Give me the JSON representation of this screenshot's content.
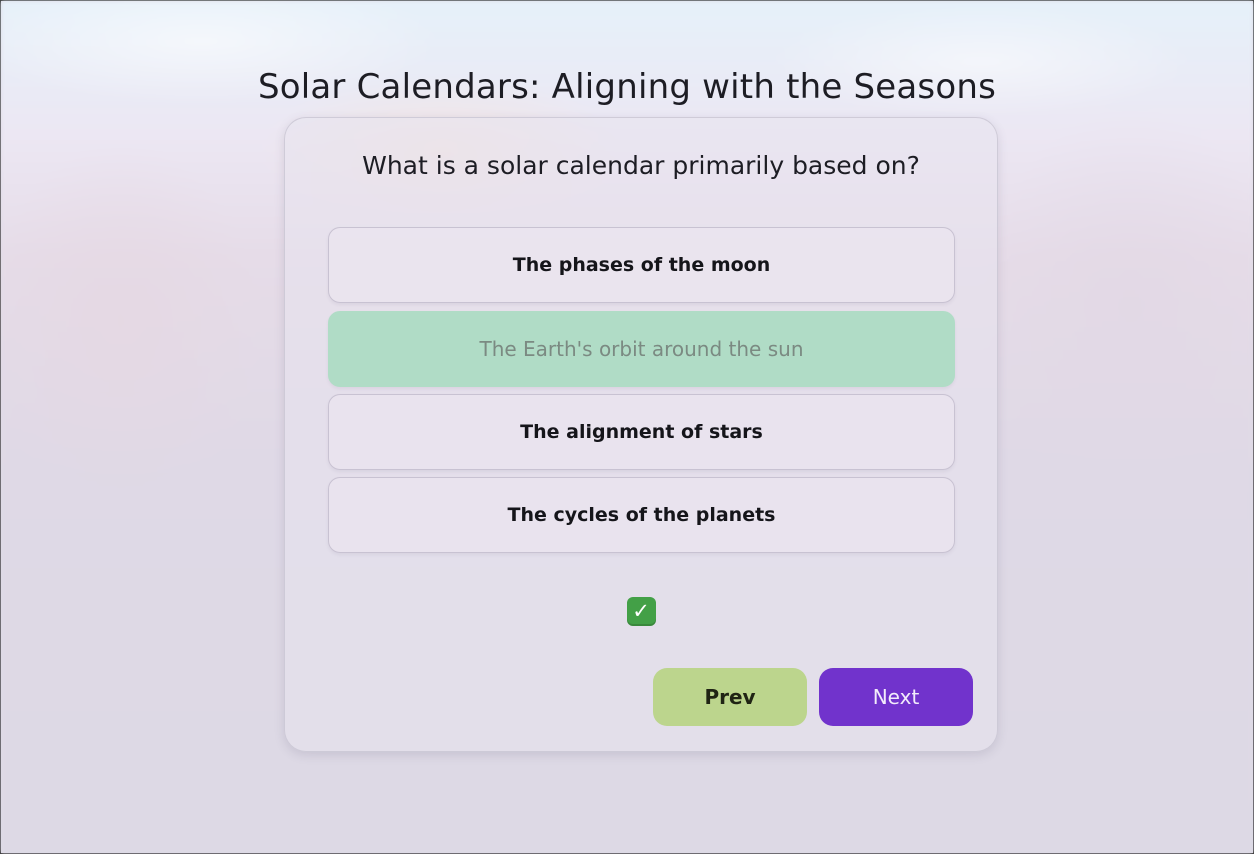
{
  "page": {
    "title": "Solar Calendars: Aligning with the Seasons"
  },
  "quiz": {
    "question": "What is a solar calendar primarily based on?",
    "answers": [
      {
        "label": "The phases of the moon",
        "state": "default"
      },
      {
        "label": "The Earth's orbit around the sun",
        "state": "correct"
      },
      {
        "label": "The alignment of stars",
        "state": "default"
      },
      {
        "label": "The cycles of the planets",
        "state": "default"
      }
    ],
    "feedback": {
      "icon": "check-mark-icon",
      "symbol": "✓",
      "color": "#43a047"
    },
    "nav": {
      "prev_label": "Prev",
      "next_label": "Next"
    }
  },
  "colors": {
    "correct_answer_bg": "#b0dcc6",
    "prev_button_bg": "#bcd58d",
    "next_button_bg": "#7133cc"
  }
}
